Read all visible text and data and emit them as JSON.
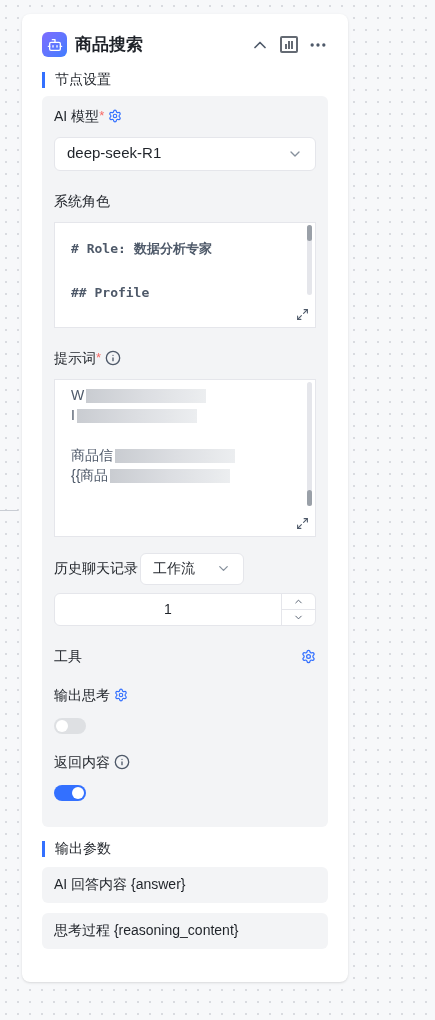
{
  "node": {
    "title": "商品搜索"
  },
  "node_settings": {
    "heading": "节点设置",
    "model": {
      "label": "AI 模型",
      "required_mark": "*",
      "value": "deep-seek-R1"
    },
    "system_role": {
      "label": "系统角色",
      "paragraphs": [
        [
          "# Role: 数据分析专家"
        ],
        [
          "## Profile"
        ]
      ]
    },
    "prompt": {
      "label": "提示词",
      "required_mark": "*",
      "paragraphs": [
        [
          "W",
          "I"
        ],
        [
          "商品信",
          "{{商品"
        ]
      ]
    },
    "history": {
      "label": "历史聊天记录",
      "mode": "工作流",
      "count": "1"
    },
    "tools": {
      "label": "工具"
    },
    "toggles": [
      {
        "label": "输出思考",
        "kind": "settings",
        "on": false
      },
      {
        "label": "返回内容",
        "kind": "info",
        "on": true
      }
    ]
  },
  "output_params": {
    "heading": "输出参数",
    "items": [
      "AI 回答内容 {answer}",
      "思考过程 {reasoning_content}"
    ]
  }
}
